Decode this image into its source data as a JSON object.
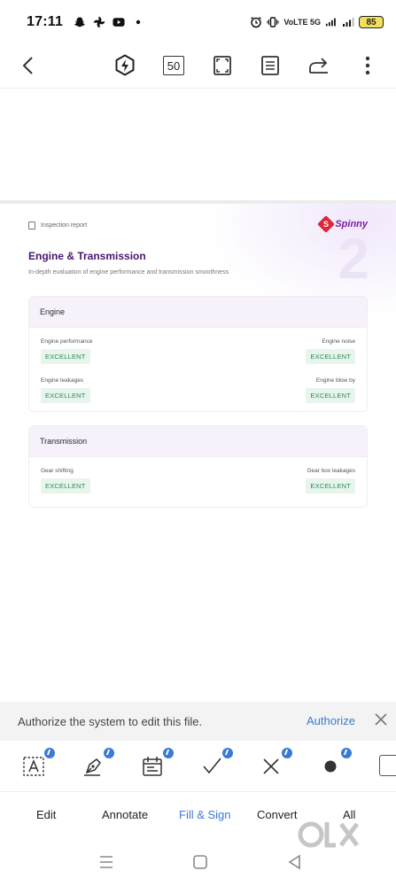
{
  "status_bar": {
    "time": "17:11",
    "network": "VoLTE 5G",
    "battery": "85"
  },
  "toolbar": {
    "page_number": "50"
  },
  "document": {
    "report_label": "Inspection report",
    "brand": "Spinny",
    "brand_mark": "S",
    "section_number": "2",
    "title": "Engine & Transmission",
    "subtitle": "In-depth evaluation of engine performance and transmission smoothness",
    "cards": [
      {
        "heading": "Engine",
        "items": [
          {
            "label": "Engine performance",
            "value": "EXCELLENT"
          },
          {
            "label": "Engine noise",
            "value": "EXCELLENT"
          },
          {
            "label": "Engine leakages",
            "value": "EXCELLENT"
          },
          {
            "label": "Engine blow by",
            "value": "EXCELLENT"
          }
        ]
      },
      {
        "heading": "Transmission",
        "items": [
          {
            "label": "Gear shifting",
            "value": "EXCELLENT"
          },
          {
            "label": "Gear box leakages",
            "value": "EXCELLENT"
          }
        ]
      }
    ]
  },
  "authorize_banner": {
    "message": "Authorize the system to edit this file.",
    "action": "Authorize"
  },
  "tabs": [
    "Edit",
    "Annotate",
    "Fill & Sign",
    "Convert",
    "All"
  ],
  "active_tab": "Fill & Sign",
  "accent_color": "#3a7bd5",
  "watermark": "olx"
}
